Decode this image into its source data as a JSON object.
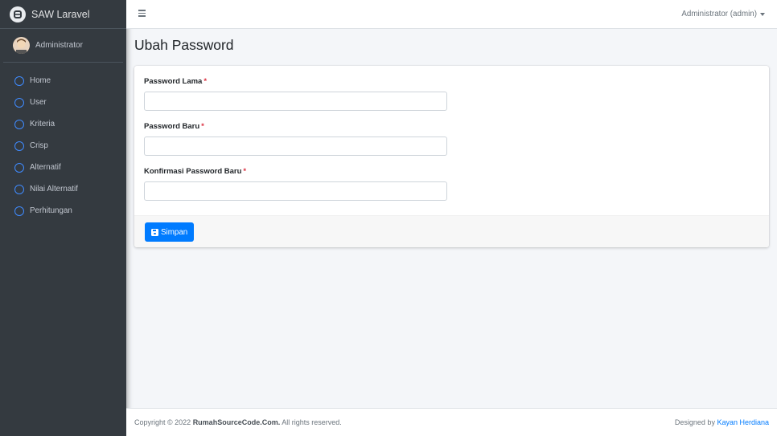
{
  "brand": {
    "name": "SAW Laravel"
  },
  "user": {
    "name": "Administrator"
  },
  "sidebar": {
    "items": [
      {
        "label": "Home"
      },
      {
        "label": "User"
      },
      {
        "label": "Kriteria"
      },
      {
        "label": "Crisp"
      },
      {
        "label": "Alternatif"
      },
      {
        "label": "Nilai Alternatif"
      },
      {
        "label": "Perhitungan"
      }
    ]
  },
  "navbar": {
    "user_menu": "Administrator (admin)"
  },
  "page": {
    "title": "Ubah Password"
  },
  "form": {
    "fields": [
      {
        "label": "Password Lama",
        "required": "*",
        "value": ""
      },
      {
        "label": "Password Baru",
        "required": "*",
        "value": ""
      },
      {
        "label": "Konfirmasi Password Baru",
        "required": "*",
        "value": ""
      }
    ],
    "submit_label": "Simpan"
  },
  "footer": {
    "copyright_prefix": "Copyright © 2022 ",
    "copyright_site": "RumahSourceCode.Com.",
    "copyright_suffix": " All rights reserved.",
    "designed_by": "Designed by ",
    "designer": "Kayan Herdiana"
  },
  "colors": {
    "accent": "#007bff",
    "sidebar_bg": "#343a40",
    "required": "#dc3545"
  }
}
